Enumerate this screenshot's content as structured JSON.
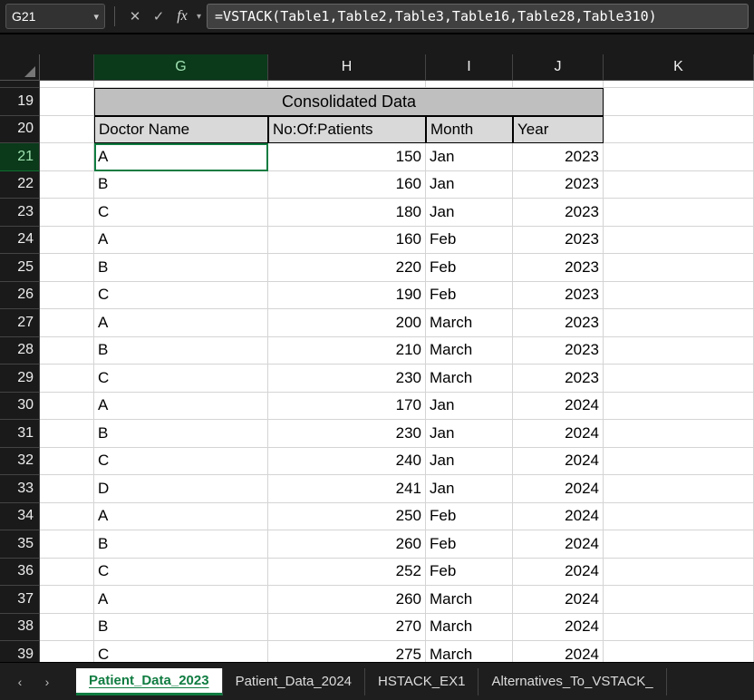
{
  "namebox": "G21",
  "formula": "=VSTACK(Table1,Table2,Table3,Table16,Table28,Table310)",
  "columns": [
    "G",
    "H",
    "I",
    "J",
    "K"
  ],
  "selected_column": "G",
  "row_numbers": [
    19,
    20,
    21,
    22,
    23,
    24,
    25,
    26,
    27,
    28,
    29,
    30,
    31,
    32,
    33,
    34,
    35,
    36,
    37,
    38,
    39
  ],
  "selected_row": 21,
  "title": "Consolidated Data",
  "headers": {
    "g": "Doctor Name",
    "h": "No:Of:Patients",
    "i": "Month",
    "j": "Year"
  },
  "data_rows": [
    {
      "g": "A",
      "h": "150",
      "i": "Jan",
      "j": "2023"
    },
    {
      "g": "B",
      "h": "160",
      "i": "Jan",
      "j": "2023"
    },
    {
      "g": "C",
      "h": "180",
      "i": "Jan",
      "j": "2023"
    },
    {
      "g": "A",
      "h": "160",
      "i": "Feb",
      "j": "2023"
    },
    {
      "g": "B",
      "h": "220",
      "i": "Feb",
      "j": "2023"
    },
    {
      "g": "C",
      "h": "190",
      "i": "Feb",
      "j": "2023"
    },
    {
      "g": "A",
      "h": "200",
      "i": "March",
      "j": "2023"
    },
    {
      "g": "B",
      "h": "210",
      "i": "March",
      "j": "2023"
    },
    {
      "g": "C",
      "h": "230",
      "i": "March",
      "j": "2023"
    },
    {
      "g": "A",
      "h": "170",
      "i": "Jan",
      "j": "2024"
    },
    {
      "g": "B",
      "h": "230",
      "i": "Jan",
      "j": "2024"
    },
    {
      "g": "C",
      "h": "240",
      "i": "Jan",
      "j": "2024"
    },
    {
      "g": "D",
      "h": "241",
      "i": "Jan",
      "j": "2024"
    },
    {
      "g": "A",
      "h": "250",
      "i": "Feb",
      "j": "2024"
    },
    {
      "g": "B",
      "h": "260",
      "i": "Feb",
      "j": "2024"
    },
    {
      "g": "C",
      "h": "252",
      "i": "Feb",
      "j": "2024"
    },
    {
      "g": "A",
      "h": "260",
      "i": "March",
      "j": "2024"
    },
    {
      "g": "B",
      "h": "270",
      "i": "March",
      "j": "2024"
    },
    {
      "g": "C",
      "h": "275",
      "i": "March",
      "j": "2024"
    }
  ],
  "tabs": [
    "Patient_Data_2023",
    "Patient_Data_2024",
    "HSTACK_EX1",
    "Alternatives_To_VSTACK_"
  ],
  "active_tab": 0,
  "chart_data": {
    "type": "table",
    "title": "Consolidated Data",
    "columns": [
      "Doctor Name",
      "No:Of:Patients",
      "Month",
      "Year"
    ],
    "rows": [
      [
        "A",
        150,
        "Jan",
        2023
      ],
      [
        "B",
        160,
        "Jan",
        2023
      ],
      [
        "C",
        180,
        "Jan",
        2023
      ],
      [
        "A",
        160,
        "Feb",
        2023
      ],
      [
        "B",
        220,
        "Feb",
        2023
      ],
      [
        "C",
        190,
        "Feb",
        2023
      ],
      [
        "A",
        200,
        "March",
        2023
      ],
      [
        "B",
        210,
        "March",
        2023
      ],
      [
        "C",
        230,
        "March",
        2023
      ],
      [
        "A",
        170,
        "Jan",
        2024
      ],
      [
        "B",
        230,
        "Jan",
        2024
      ],
      [
        "C",
        240,
        "Jan",
        2024
      ],
      [
        "D",
        241,
        "Jan",
        2024
      ],
      [
        "A",
        250,
        "Feb",
        2024
      ],
      [
        "B",
        260,
        "Feb",
        2024
      ],
      [
        "C",
        252,
        "Feb",
        2024
      ],
      [
        "A",
        260,
        "March",
        2024
      ],
      [
        "B",
        270,
        "March",
        2024
      ],
      [
        "C",
        275,
        "March",
        2024
      ]
    ]
  }
}
